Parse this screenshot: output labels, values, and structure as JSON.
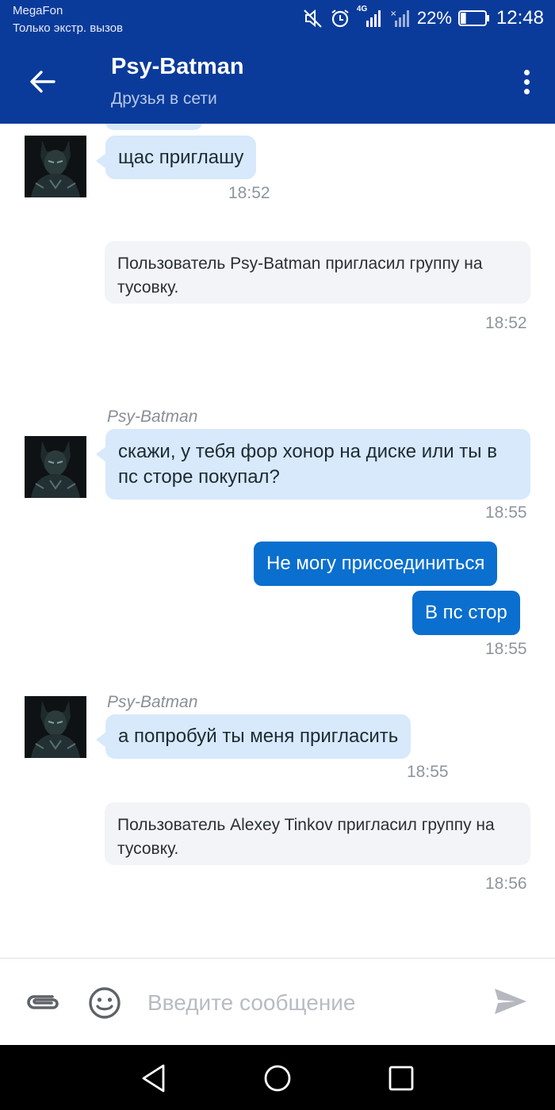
{
  "status_bar": {
    "carrier": "MegaFon",
    "carrier_status": "Только экстр. вызов",
    "network": "4G",
    "battery": "22%",
    "battery_level": 0.22,
    "time": "12:48"
  },
  "header": {
    "title": "Psy-Batman",
    "subtitle": "Друзья в сети"
  },
  "messages": {
    "m1": {
      "text": "щас приглашу",
      "time": "18:52"
    },
    "sys1": {
      "text": "Пользователь Psy-Batman пригласил группу на тусовку.",
      "time": "18:52"
    },
    "m2": {
      "sender": "Psy-Batman",
      "text": "скажи, у тебя фор хонор на диске или ты в пс сторе покупал?",
      "time": "18:55"
    },
    "out1": {
      "text": "Не могу присоединиться"
    },
    "out2": {
      "text": "В пс стор",
      "time": "18:55"
    },
    "m3": {
      "sender": "Psy-Batman",
      "text": "а попробуй ты меня пригласить",
      "time": "18:55"
    },
    "sys2": {
      "text": "Пользователь Alexey Tinkov пригласил группу на тусовку.",
      "time": "18:56"
    }
  },
  "composer": {
    "placeholder": "Введите сообщение"
  },
  "colors": {
    "header_bg": "#0a3b9b",
    "incoming_bubble": "#d7e9fb",
    "outgoing_bubble": "#0a6fce",
    "system_bubble": "#f3f4f7"
  },
  "icons": {
    "back": "arrow-left-icon",
    "more": "more-vertical-icon",
    "attach": "paperclip-icon",
    "emoji": "smiley-icon",
    "send": "send-icon"
  }
}
